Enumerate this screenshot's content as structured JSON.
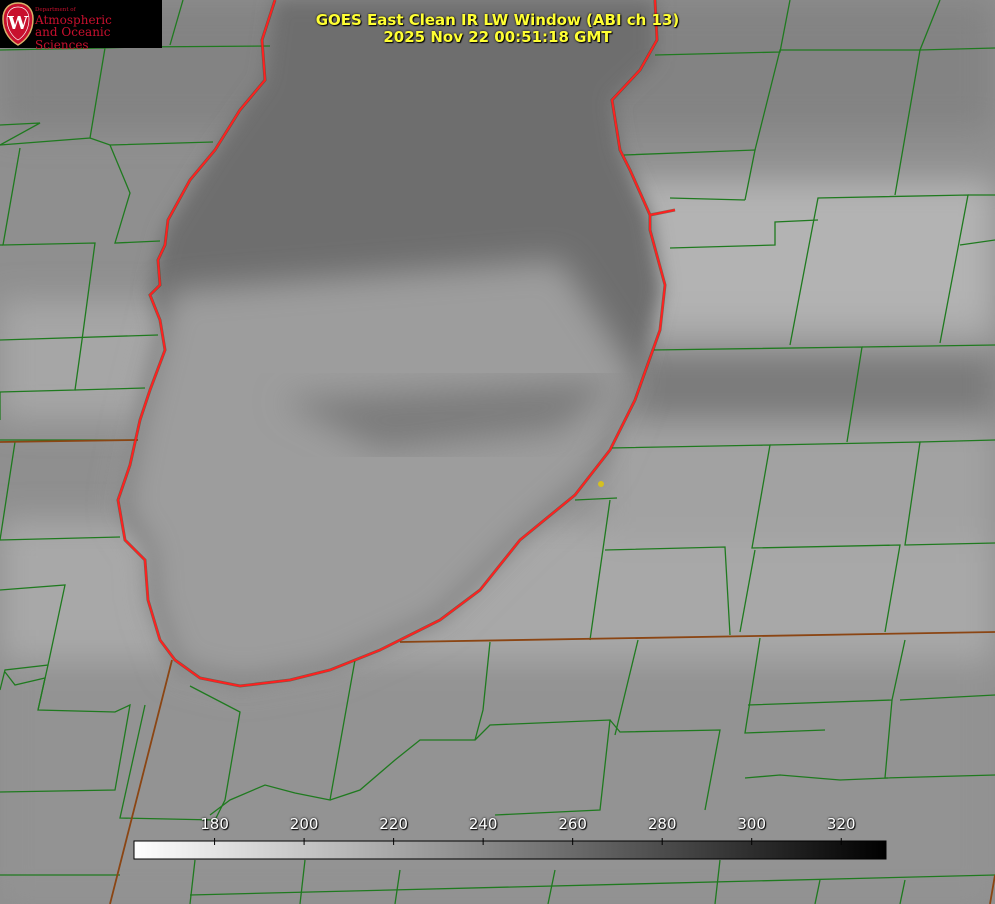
{
  "title": {
    "line1": "GOES East Clean IR LW Window (ABI ch 13)",
    "line2": "2025 Nov 22 00:51:18 GMT"
  },
  "logo": {
    "line1": "Department of",
    "line2": "Atmospheric",
    "line3": "and Oceanic Sciences",
    "emblem_letter": "W"
  },
  "colorbar": {
    "min": 162,
    "max": 330,
    "ticks": [
      "180",
      "200",
      "220",
      "240",
      "260",
      "280",
      "300",
      "320"
    ],
    "gradient": "white-to-black"
  },
  "colors": {
    "title": "#ffff33",
    "county_borders": "#1f7a1f",
    "state_borders": "#8b4513",
    "shoreline": "#ff2020",
    "marker": "#d4c020",
    "logo_red": "#c8102e"
  }
}
